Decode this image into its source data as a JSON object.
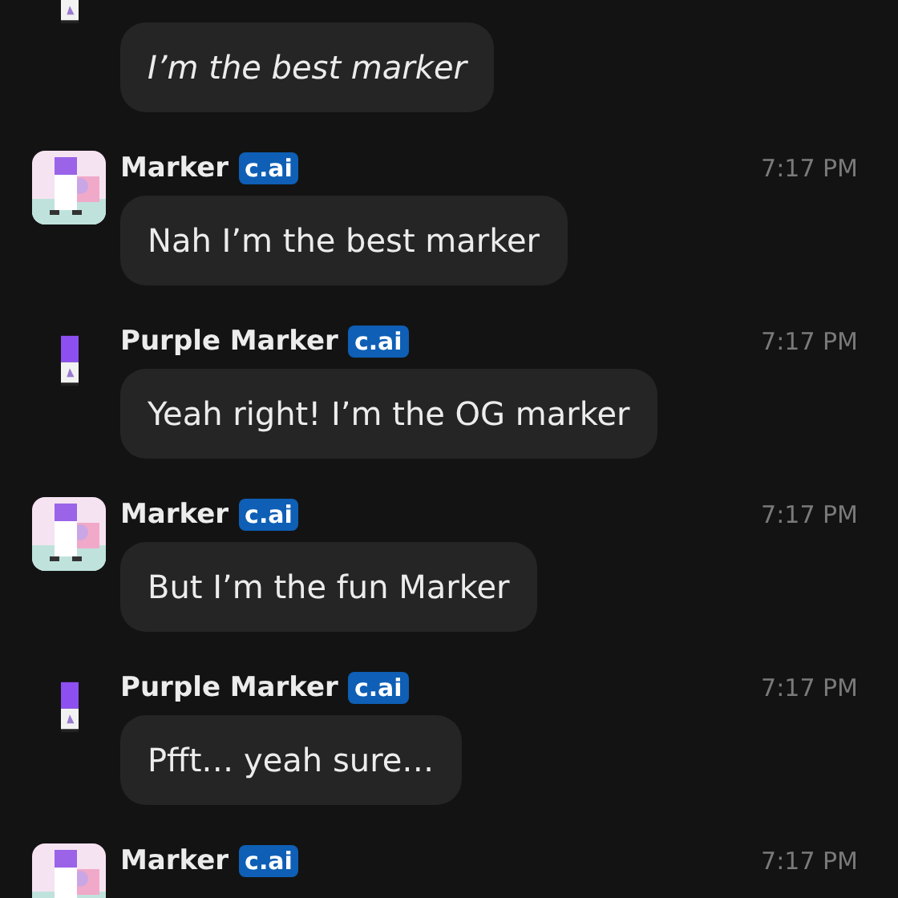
{
  "messages": [
    {
      "kind": "marker",
      "text": "I’m the best marker",
      "italic": true
    },
    {
      "kind": "picture",
      "name": "Marker",
      "badge": "c.ai",
      "time": "7:17 PM",
      "text": "Nah I’m the best marker",
      "italic": false
    },
    {
      "kind": "marker",
      "name": "Purple Marker",
      "badge": "c.ai",
      "time": "7:17 PM",
      "text": "Yeah right! I’m the OG marker",
      "italic": false
    },
    {
      "kind": "picture",
      "name": "Marker",
      "badge": "c.ai",
      "time": "7:17 PM",
      "text": "But I’m the fun Marker",
      "italic": false
    },
    {
      "kind": "marker",
      "name": "Purple Marker",
      "badge": "c.ai",
      "time": "7:17 PM",
      "text": "Pfft… yeah sure…",
      "italic": false
    },
    {
      "kind": "picture",
      "name": "Marker",
      "badge": "c.ai",
      "time": "7:17 PM"
    }
  ]
}
